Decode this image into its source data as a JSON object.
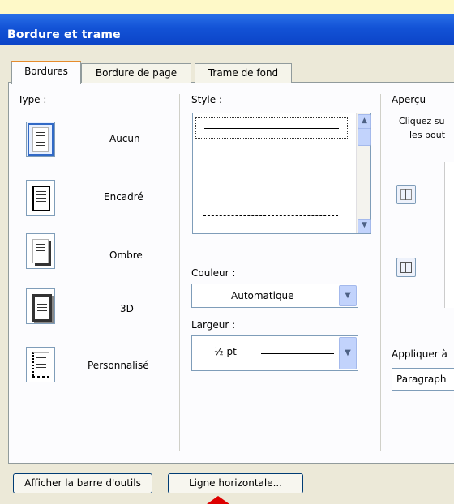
{
  "window": {
    "title": "Bordure et trame"
  },
  "tabs": [
    {
      "label": "Bordures",
      "active": true
    },
    {
      "label": "Bordure de page",
      "active": false
    },
    {
      "label": "Trame de fond",
      "active": false
    }
  ],
  "type_section": {
    "label": "Type :",
    "presets": [
      {
        "label": "Aucun",
        "selected": true
      },
      {
        "label": "Encadré",
        "selected": false
      },
      {
        "label": "Ombre",
        "selected": false
      },
      {
        "label": "3D",
        "selected": false
      },
      {
        "label": "Personnalisé",
        "selected": false
      }
    ]
  },
  "style_section": {
    "label": "Style :",
    "line_styles": [
      "solid",
      "dotted",
      "dashed-fine",
      "dashed"
    ],
    "couleur_label": "Couleur :",
    "couleur_value": "Automatique",
    "largeur_label": "Largeur :",
    "largeur_value": "½ pt"
  },
  "apercu_section": {
    "label": "Aperçu",
    "hint_line1": "Cliquez su",
    "hint_line2": "les bout",
    "appliquer_label": "Appliquer à",
    "appliquer_value": "Paragraph"
  },
  "buttons": {
    "afficher_barre": "Afficher la barre d'outils",
    "ligne_horizontale": "Ligne horizontale..."
  },
  "colors": {
    "title_bar": "#0c44c8",
    "active_tab_accent": "#e68b2c",
    "arrow": "#dd0000"
  }
}
